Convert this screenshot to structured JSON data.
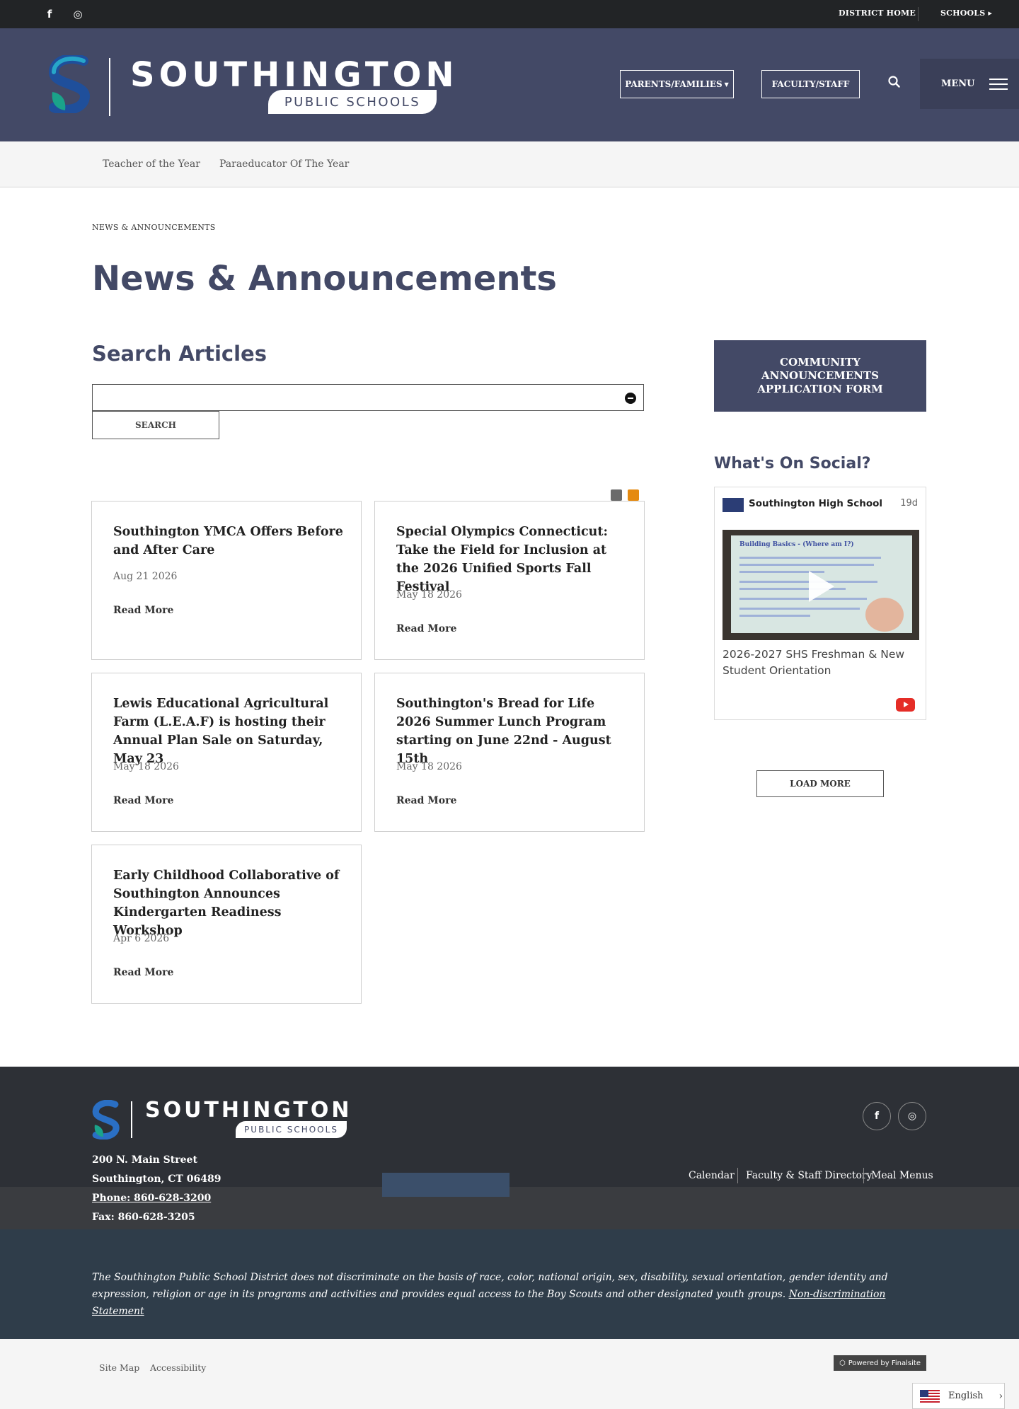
{
  "topbar": {
    "social": [
      {
        "icon": "facebook-icon",
        "glyph": "f"
      },
      {
        "icon": "instagram-icon",
        "glyph": "◎"
      }
    ],
    "district_home": "DISTRICT HOME",
    "schools": "SCHOOLS"
  },
  "header": {
    "logo_word": "SOUTHINGTON",
    "logo_sub": "PUBLIC SCHOOLS",
    "parents_button": "PARENTS/FAMILIES",
    "faculty_button": "FACULTY/STAFF",
    "menu_label": "MENU",
    "colors": {
      "brand": "#434966",
      "topbar": "#222426"
    }
  },
  "subnav": [
    "Teacher of the Year",
    "Paraeducator Of The Year"
  ],
  "breadcrumb": "NEWS & ANNOUNCEMENTS",
  "page_title": "News & Announcements",
  "search": {
    "heading": "Search Articles",
    "value": "",
    "button": "SEARCH"
  },
  "articles": [
    {
      "title": "Southington YMCA Offers Before and After Care",
      "date": "Aug 21 2026",
      "link": "Read More"
    },
    {
      "title": "Special Olympics Connecticut: Take the Field for Inclusion at the 2026 Unified Sports Fall Festival",
      "date": "May 18 2026",
      "link": "Read More"
    },
    {
      "title": "Lewis Educational Agricultural Farm (L.E.A.F) is hosting their Annual Plan Sale on Saturday, May 23",
      "date": "May 18 2026",
      "link": "Read More"
    },
    {
      "title": "Southington's Bread for Life 2026 Summer Lunch Program starting on June 22nd - August 15th",
      "date": "May 18 2026",
      "link": "Read More"
    },
    {
      "title": "Early Childhood Collaborative of Southington Announces Kindergarten Readiness Workshop",
      "date": "Apr 6 2026",
      "link": "Read More"
    }
  ],
  "sidebar": {
    "community_button": "COMMUNITY ANNOUNCEMENTS APPLICATION FORM",
    "social_heading": "What's On Social?",
    "post": {
      "account": "Southington High School",
      "age": "19d",
      "slide_title": "Building Basics - (Where am I?)",
      "caption": "2026-2027 SHS Freshman & New Student Orientation"
    },
    "load_more": "LOAD MORE"
  },
  "footer": {
    "logo_word": "SOUTHINGTON",
    "logo_sub": "PUBLIC SCHOOLS",
    "address1": "200 N. Main Street",
    "address2": "Southington, CT  06489",
    "phone": "Phone: 860-628-3200",
    "fax": "Fax: 860-628-3205",
    "links": [
      "Calendar",
      "Faculty & Staff Directory",
      "Meal Menus"
    ],
    "disclaimer": "The Southington Public School District does not discriminate on the basis of race, color, national origin, sex, disability, sexual orientation, gender identity and expression, religion or age in its programs and activities and provides equal access to the Boy Scouts and other designated youth groups.",
    "disclaimer_link": "Non-discrimination Statement"
  },
  "bottom": {
    "site_map": "Site Map",
    "accessibility": "Accessibility",
    "powered": "Powered by Finalsite",
    "language": "English"
  }
}
